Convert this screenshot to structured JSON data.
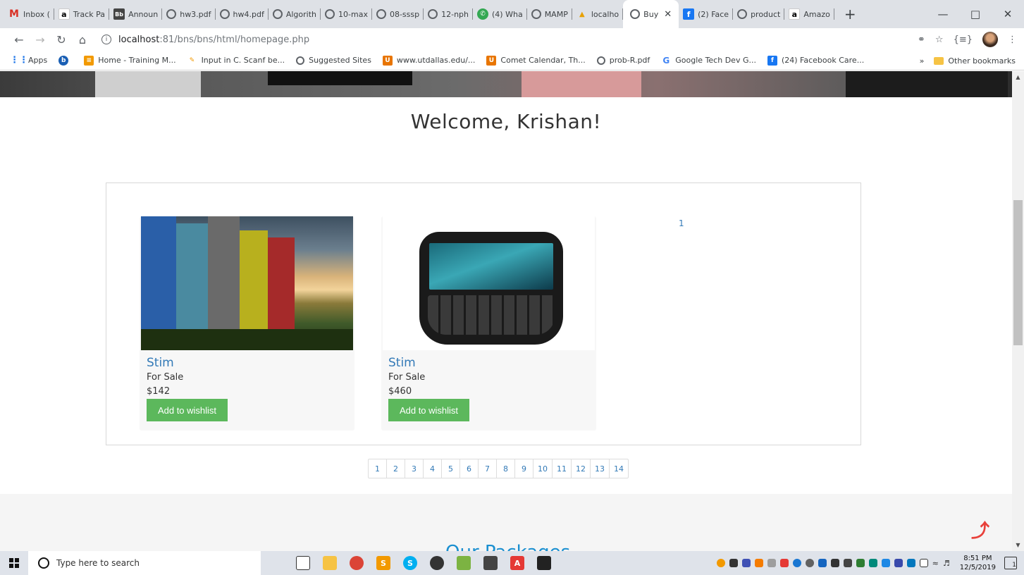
{
  "browser": {
    "tabs": [
      {
        "label": "Inbox (",
        "icon": "gmail-icon"
      },
      {
        "label": "Track Pa",
        "icon": "amazon-icon"
      },
      {
        "label": "Announ",
        "icon": "blackboard-icon"
      },
      {
        "label": "hw3.pdf",
        "icon": "globe-icon"
      },
      {
        "label": "hw4.pdf",
        "icon": "globe-icon"
      },
      {
        "label": "Algorith",
        "icon": "globe-icon"
      },
      {
        "label": "10-max",
        "icon": "globe-icon"
      },
      {
        "label": "08-sssp",
        "icon": "globe-icon"
      },
      {
        "label": "12-nph",
        "icon": "globe-icon"
      },
      {
        "label": "(4) Wha",
        "icon": "whatsapp-icon"
      },
      {
        "label": "MAMP",
        "icon": "globe-icon"
      },
      {
        "label": "localho",
        "icon": "phpmyadmin-icon"
      },
      {
        "label": "Buy",
        "icon": "globe-icon",
        "active": true
      },
      {
        "label": "(2) Face",
        "icon": "facebook-icon"
      },
      {
        "label": "product",
        "icon": "globe-icon"
      },
      {
        "label": "Amazo",
        "icon": "amazon-icon"
      }
    ],
    "new_tab": "+",
    "url_host": "localhost",
    "url_path": ":81/bns/bns/html/homepage.php",
    "bookmarks": [
      {
        "label": "Apps",
        "icon": "apps-grid-icon"
      },
      {
        "label": "",
        "icon": "circle-b-icon"
      },
      {
        "label": "Home - Training M...",
        "icon": "training-icon"
      },
      {
        "label": "Input in C. Scanf be...",
        "icon": "pen-icon"
      },
      {
        "label": "Suggested Sites",
        "icon": "globe-icon"
      },
      {
        "label": "www.utdallas.edu/...",
        "icon": "utd-icon"
      },
      {
        "label": "Comet Calendar, Th...",
        "icon": "utd-icon"
      },
      {
        "label": "prob-R.pdf",
        "icon": "globe-icon"
      },
      {
        "label": "Google Tech Dev G...",
        "icon": "google-icon"
      },
      {
        "label": "(24) Facebook Care...",
        "icon": "facebook-icon"
      }
    ],
    "bookmarks_overflow": "»",
    "other_bookmarks": "Other bookmarks"
  },
  "page": {
    "welcome": "Welcome, Krishan!",
    "products": [
      {
        "title": "Stim",
        "status": "For Sale",
        "price": "$142",
        "button": "Add to wishlist",
        "image": "colorful-houses"
      },
      {
        "title": "Stim",
        "status": "For Sale",
        "price": "$460",
        "button": "Add to wishlist",
        "image": "blackberry-phone"
      }
    ],
    "grid_page": "1",
    "pagination": [
      "1",
      "2",
      "3",
      "4",
      "5",
      "6",
      "7",
      "8",
      "9",
      "10",
      "11",
      "12",
      "13",
      "14"
    ],
    "footer_heading": "Our Packages"
  },
  "taskbar": {
    "search_placeholder": "Type here to search",
    "time": "8:51 PM",
    "date": "12/5/2019",
    "notifications": "1"
  }
}
